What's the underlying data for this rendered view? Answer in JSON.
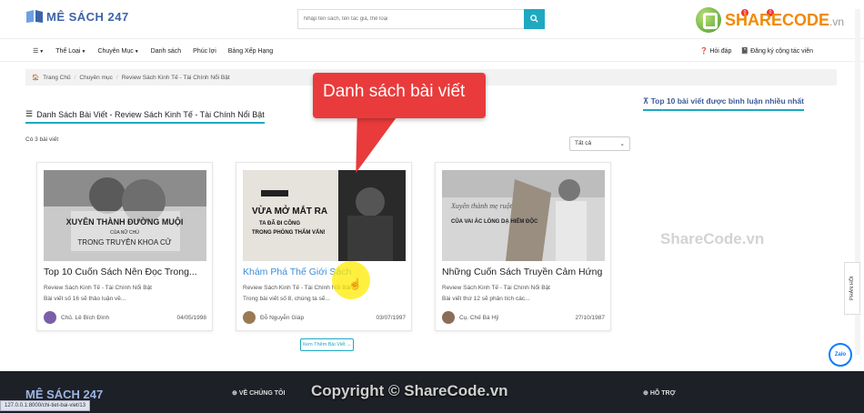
{
  "header": {
    "logo_text": "MÊ SÁCH 247",
    "search_placeholder": "Nhập tên sách, tên tác giả, thể loại",
    "sharecode_brand": "SHARECODE",
    "sharecode_tld": ".vn",
    "notification_count": "0",
    "message_count": "0"
  },
  "nav": {
    "items": [
      "Thể Loại",
      "Chuyên Mục",
      "Danh sách",
      "Phúc lợi",
      "Bảng Xếp Hạng"
    ],
    "right": [
      "Hỏi đáp",
      "Đăng ký cộng tác viên"
    ]
  },
  "breadcrumb": [
    "Trang Chủ",
    "Chuyên mục",
    "Review Sách Kinh Tế - Tài Chính Nổi Bật"
  ],
  "section": {
    "title": "Danh Sách Bài Viết - Review Sách Kinh Tế - Tài Chính Nổi Bật",
    "count_text": "Có 3 bài viết",
    "sort_value": "Tất cả",
    "side_title": "Top 10 bài viết được bình luận nhiều nhất"
  },
  "tooltip": "Danh sách bài viết",
  "cards": [
    {
      "title": "Top 10 Cuốn Sách Nên Đọc Trong...",
      "category": "Review Sách Kinh Tế - Tài Chính Nổi Bật",
      "desc": "Bài viết số 16 sẽ thảo luận về...",
      "author": "Chủ. Lê Bích Đình",
      "date": "04/05/1998",
      "cover_line1": "XUYÊN THÀNH ĐƯỜNG MUỘI",
      "cover_line2": "CỦA NỮ CHỦ",
      "cover_line3": "TRONG TRUYỆN KHOA CỬ",
      "avatar_color": "#7a5fa8"
    },
    {
      "title": "Khám Phá Thế Giới Sách",
      "category": "Review Sách Kinh Tế - Tài Chính Nổi Bật",
      "desc": "Trong bài viết số 8, chúng ta sẽ...",
      "author": "Đỗ Nguyễn Giáp",
      "date": "03/07/1997",
      "cover_line1": "VỪA MỞ MẮT RA",
      "cover_line2": "TA ĐÃ ĐI CÔNG",
      "cover_line3": "TRONG PHÒNG THẨM VẤN!",
      "avatar_color": "#9a7a55"
    },
    {
      "title": "Những Cuốn Sách Truyền Cảm Hứng",
      "category": "Review Sách Kinh Tế - Tài Chính Nổi Bật",
      "desc": "Bài viết thứ 12 sẽ phân tích các...",
      "author": "Cụ. Chế Bá Hỷ",
      "date": "27/10/1987",
      "cover_line1": "Xuyên thành mẹ ruột",
      "cover_line2": "CỦA VAI ÁC LÒNG DẠ HIỂM ĐỘC",
      "cover_line3": "",
      "avatar_color": "#8a6e5a"
    }
  ],
  "more_button": "Xem Thêm Bài Viết →",
  "watermark": "ShareCode.vn",
  "side_tab": "PHẢN HỒI",
  "zalo": "Zalo",
  "footer": {
    "logo": "MÊ SÁCH 247",
    "col1": "VỀ CHÚNG TÔI",
    "col2": "HỖ TRỢ",
    "copyright": "Copyright © ShareCode.vn",
    "status_url": "127.0.0.1:8000/chi-tiet-bai-viet/13"
  }
}
